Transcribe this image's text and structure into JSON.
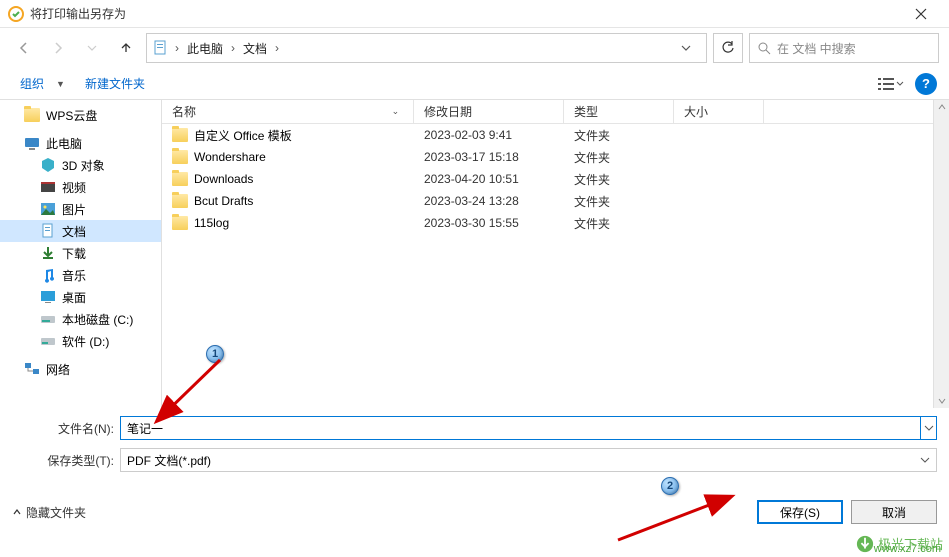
{
  "title": "将打印输出另存为",
  "breadcrumbs": {
    "root": "此电脑",
    "folder": "文档"
  },
  "search_placeholder": "在 文档 中搜索",
  "toolbar": {
    "organize": "组织",
    "new_folder": "新建文件夹"
  },
  "columns": {
    "name": "名称",
    "date": "修改日期",
    "type": "类型",
    "size": "大小"
  },
  "sidebar": {
    "wps_cloud": "WPS云盘",
    "this_pc": "此电脑",
    "objects3d": "3D 对象",
    "videos": "视频",
    "pictures": "图片",
    "documents": "文档",
    "downloads": "下载",
    "music": "音乐",
    "desktop": "桌面",
    "local_c": "本地磁盘 (C:)",
    "soft_d": "软件 (D:)",
    "network": "网络"
  },
  "files": [
    {
      "name": "自定义 Office 模板",
      "date": "2023-02-03 9:41",
      "type": "文件夹"
    },
    {
      "name": "Wondershare",
      "date": "2023-03-17 15:18",
      "type": "文件夹"
    },
    {
      "name": "Downloads",
      "date": "2023-04-20 10:51",
      "type": "文件夹"
    },
    {
      "name": "Bcut Drafts",
      "date": "2023-03-24 13:28",
      "type": "文件夹"
    },
    {
      "name": "115log",
      "date": "2023-03-30 15:55",
      "type": "文件夹"
    }
  ],
  "labels": {
    "filename": "文件名(N):",
    "filetype": "保存类型(T):"
  },
  "filename_value": "笔记一",
  "filetype_value": "PDF 文档(*.pdf)",
  "hide_folders": "隐藏文件夹",
  "buttons": {
    "save": "保存(S)",
    "cancel": "取消"
  },
  "callouts": {
    "c1": "1",
    "c2": "2"
  },
  "watermark": {
    "name": "极光下载站",
    "url": "www.xz7.com"
  }
}
